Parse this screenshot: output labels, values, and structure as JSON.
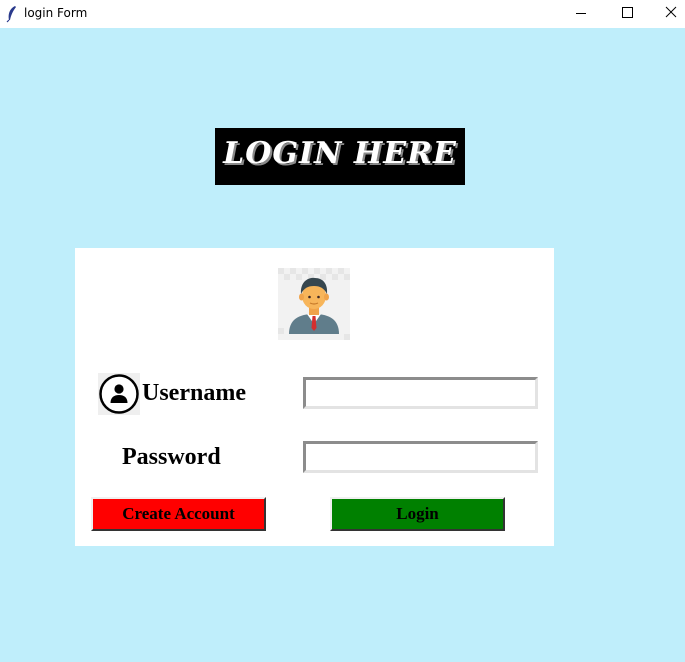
{
  "window": {
    "title": "login Form",
    "minimize_glyph": "minimize-icon",
    "maximize_glyph": "maximize-icon",
    "close_glyph": "close-icon"
  },
  "colors": {
    "background": "#bfeefb",
    "panel": "#ffffff",
    "header_bg": "#000000",
    "create_button": "#ff0000",
    "login_button": "#008000"
  },
  "header": {
    "title": "LOGIN HERE"
  },
  "form": {
    "avatar_icon": "person-avatar-icon",
    "user_icon": "user-circle-icon",
    "username_label": "Username",
    "username_value": "",
    "password_label": "Password",
    "password_value": "",
    "create_account_label": "Create Account",
    "login_label": "Login"
  }
}
